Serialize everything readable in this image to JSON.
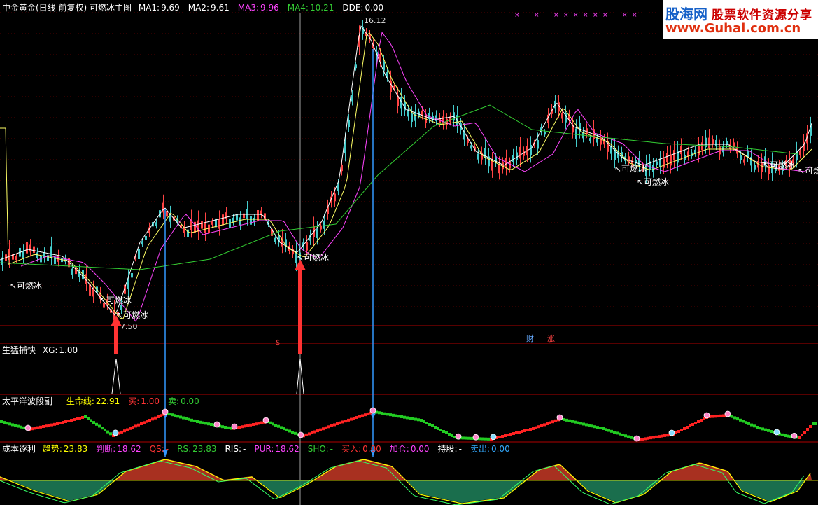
{
  "main_panel": {
    "title": "中金黄金(日线 前复权) 可燃冰主图",
    "ma": [
      {
        "label": "MA1:",
        "value": "9.69",
        "color": "#ffffff"
      },
      {
        "label": "MA2:",
        "value": "9.61",
        "color": "#ffffff"
      },
      {
        "label": "MA3:",
        "value": "9.96",
        "color": "#ff44ff"
      },
      {
        "label": "MA4:",
        "value": "10.21",
        "color": "#33cc33"
      },
      {
        "label": "DDE:",
        "value": "0.00",
        "color": "#ffffff"
      }
    ],
    "high_label": "16.12",
    "low_label": "7.50",
    "signal_label": "可燃冰",
    "markers": [
      "财",
      "涨",
      "$"
    ]
  },
  "watermark": {
    "brand": "股海网",
    "slogan": "股票软件资源分享",
    "url": "www.Guhai.com.cn"
  },
  "panel2": {
    "title": "生猛捕快",
    "xg_label": "XG:",
    "xg_value": "1.00"
  },
  "panel3": {
    "title": "太平洋波段副",
    "items": [
      {
        "label": "生命线:",
        "value": "22.91",
        "color": "#ffff00"
      },
      {
        "label": "买:",
        "value": "1.00",
        "color": "#ff3333"
      },
      {
        "label": "卖:",
        "value": "0.00",
        "color": "#33cc33"
      }
    ]
  },
  "panel4": {
    "title": "成本逐利",
    "items": [
      {
        "label": "趋势:",
        "value": "23.83",
        "color": "#ffff00"
      },
      {
        "label": "判断:",
        "value": "18.62",
        "color": "#ff44ff"
      },
      {
        "label": "QS:",
        "value": "-",
        "color": "#ff3333"
      },
      {
        "label": "RS:",
        "value": "23.83",
        "color": "#33cc33"
      },
      {
        "label": "RIS:",
        "value": "-",
        "color": "#ffffff"
      },
      {
        "label": "PUR:",
        "value": "18.62",
        "color": "#ff44ff"
      },
      {
        "label": "SHO:",
        "value": "-",
        "color": "#33cc33"
      },
      {
        "label": "买入:",
        "value": "0.00",
        "color": "#ff3333"
      },
      {
        "label": "加仓:",
        "value": "0.00",
        "color": "#ff44ff"
      },
      {
        "label": "持股:",
        "value": "-",
        "color": "#ffffff"
      },
      {
        "label": "卖出:",
        "value": "0.00",
        "color": "#33aaff"
      }
    ]
  }
}
